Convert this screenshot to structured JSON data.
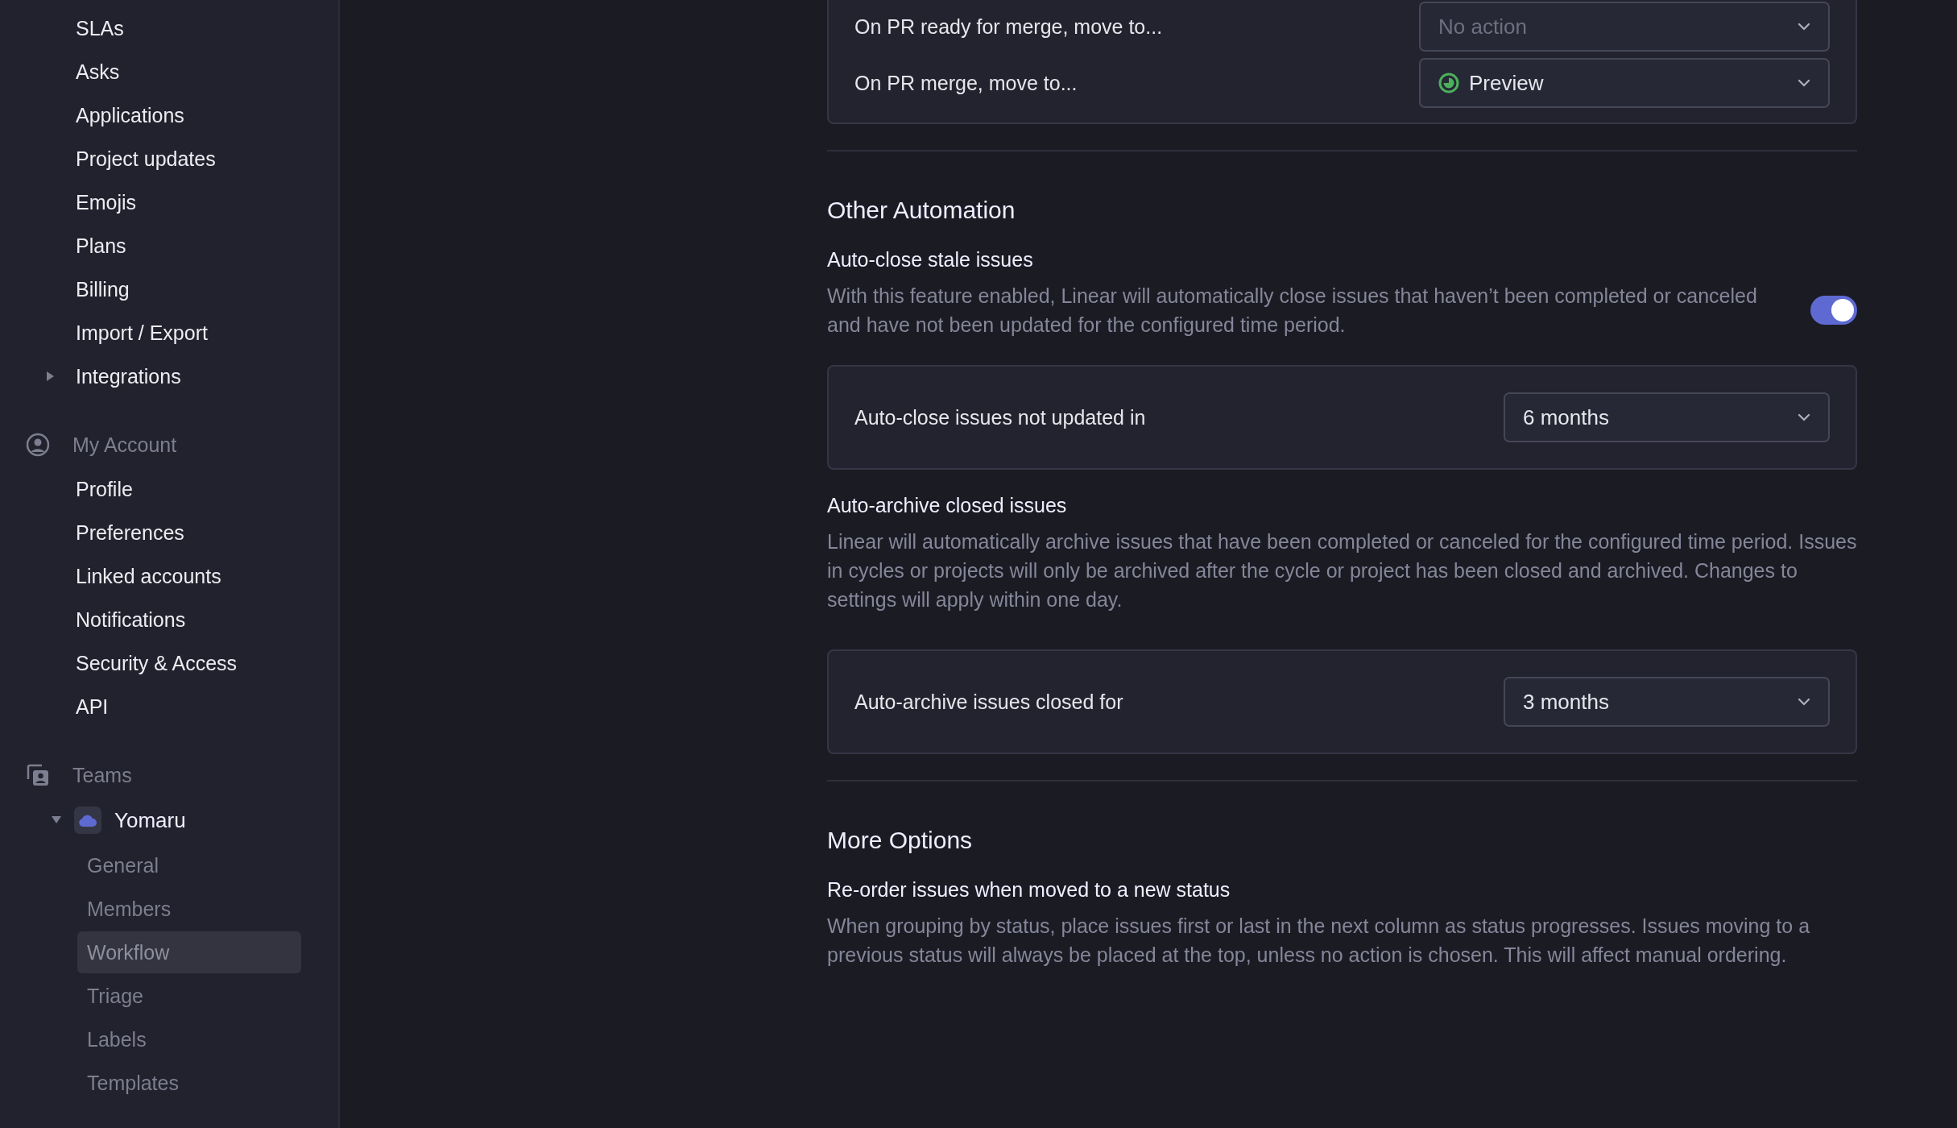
{
  "sidebar": {
    "workspace_items": [
      {
        "kind": "link",
        "label": "SLAs"
      },
      {
        "kind": "link",
        "label": "Asks"
      },
      {
        "kind": "link",
        "label": "Applications"
      },
      {
        "kind": "link",
        "label": "Project updates"
      },
      {
        "kind": "link",
        "label": "Emojis"
      },
      {
        "kind": "link",
        "label": "Plans"
      },
      {
        "kind": "link",
        "label": "Billing"
      },
      {
        "kind": "link",
        "label": "Import / Export"
      },
      {
        "kind": "folder",
        "label": "Integrations",
        "expanded": false
      }
    ],
    "account": {
      "title": "My Account",
      "items": [
        "Profile",
        "Preferences",
        "Linked accounts",
        "Notifications",
        "Security & Access",
        "API"
      ]
    },
    "teams": {
      "title": "Teams",
      "list": [
        {
          "name": "Yomaru",
          "expanded": true,
          "items": [
            {
              "label": "General",
              "selected": false
            },
            {
              "label": "Members",
              "selected": false
            },
            {
              "label": "Workflow",
              "selected": true
            },
            {
              "label": "Triage",
              "selected": false
            },
            {
              "label": "Labels",
              "selected": false
            },
            {
              "label": "Templates",
              "selected": false
            }
          ]
        }
      ]
    }
  },
  "pr_automation": {
    "rows": [
      {
        "label": "On PR ready for merge, move to...",
        "value": "No action",
        "kind": "none"
      },
      {
        "label": "On PR merge, move to...",
        "value": "Preview",
        "kind": "status"
      }
    ]
  },
  "sections": [
    {
      "title": "Other Automation",
      "settings": [
        {
          "kind": "toggle",
          "title": "Auto-close stale issues",
          "description": "With this feature enabled, Linear will automatically close issues that haven’t been completed or canceled and have not been updated for the configured time period.",
          "on": true
        },
        {
          "kind": "select",
          "label": "Auto-close issues not updated in",
          "value": "6 months"
        },
        {
          "kind": "text",
          "title": "Auto-archive closed issues",
          "description": "Linear will automatically archive issues that have been completed or canceled for the configured time period. Issues in cycles or projects will only be archived after the cycle or project has been closed and archived. Changes to settings will apply within one day."
        },
        {
          "kind": "select",
          "label": "Auto-archive issues closed for",
          "value": "3 months"
        }
      ]
    },
    {
      "title": "More Options",
      "settings": [
        {
          "kind": "text",
          "title": "Re-order issues when moved to a new status",
          "description": "When grouping by status, place issues first or last in the next column as status progresses. Issues moving to a previous status will always be placed at the top, unless no action is chosen. This will affect manual ordering."
        }
      ]
    }
  ]
}
